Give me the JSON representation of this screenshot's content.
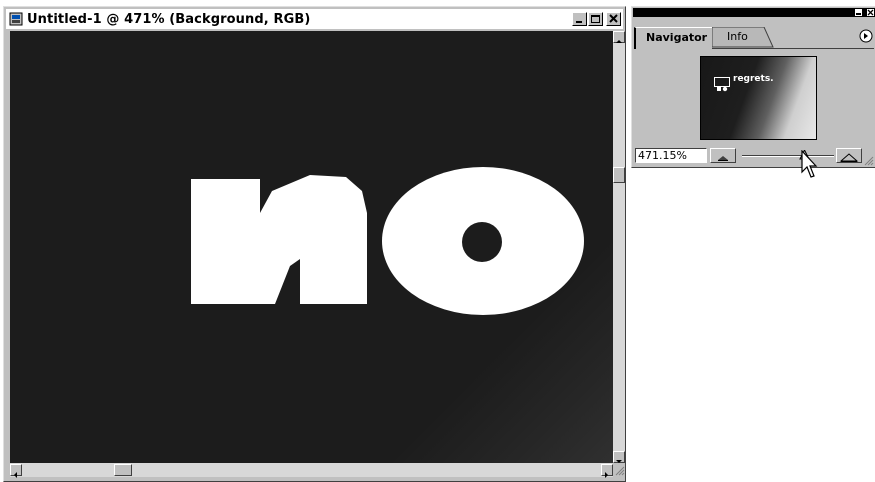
{
  "document": {
    "title": "Untitled-1 @ 471% (Background, RGB)",
    "canvas_text": "no",
    "colors": {
      "canvas_bg": "#1c1c1c",
      "text": "#ffffff"
    },
    "icons": [
      "document-icon",
      "minimize-icon",
      "maximize-icon",
      "close-icon",
      "scroll-up-icon",
      "scroll-down-icon",
      "scroll-left-icon",
      "scroll-right-icon",
      "resize-grip-icon"
    ]
  },
  "navigator": {
    "tabs": [
      {
        "label": "Navigator",
        "active": true
      },
      {
        "label": "Info",
        "active": false
      }
    ],
    "thumbnail_text": "regrets.",
    "zoom_value": "471.15%",
    "icons": [
      "palette-minimize-icon",
      "palette-close-icon",
      "palette-menu-arrow-icon",
      "zoom-out-icon",
      "zoom-in-icon",
      "zoom-slider-handle-icon"
    ]
  }
}
